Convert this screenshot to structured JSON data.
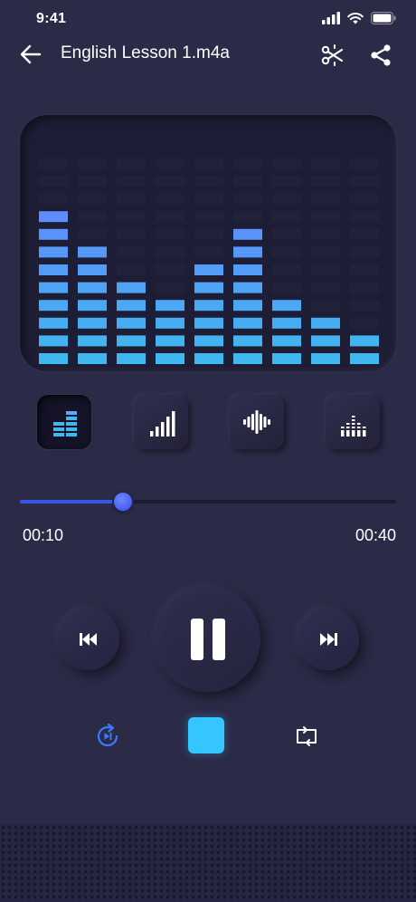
{
  "status_bar": {
    "time": "9:41"
  },
  "header": {
    "title": "English Lesson 1.m4a",
    "back_icon": "arrow-left-icon",
    "cut_icon": "scissors-icon",
    "share_icon": "share-icon"
  },
  "visualizer": {
    "levels": [
      9,
      7,
      5,
      4,
      6,
      8,
      4,
      3,
      2
    ],
    "max_level": 12,
    "colors": {
      "low": "#3fb8f0",
      "high": "#6a7dff",
      "empty": "#22213a"
    }
  },
  "modes": [
    {
      "name": "bars-mode",
      "icon": "equalizer-bars-icon",
      "active": true
    },
    {
      "name": "signal-mode",
      "icon": "signal-bars-icon",
      "active": false
    },
    {
      "name": "waveform-mode",
      "icon": "waveform-icon",
      "active": false
    },
    {
      "name": "dots-mode",
      "icon": "dotted-bars-icon",
      "active": false
    }
  ],
  "playback": {
    "current_time": "00:10",
    "total_time": "00:40",
    "progress": 0.25
  },
  "controls": {
    "previous_icon": "skip-previous-icon",
    "pause_icon": "pause-icon",
    "next_icon": "skip-next-icon",
    "replay_icon": "replay-icon",
    "stop_icon": "stop-icon",
    "repeat_icon": "repeat-icon"
  },
  "colors": {
    "background": "#2b2a47",
    "accent_blue": "#3a55e8",
    "stop_cyan": "#35c6ff"
  }
}
